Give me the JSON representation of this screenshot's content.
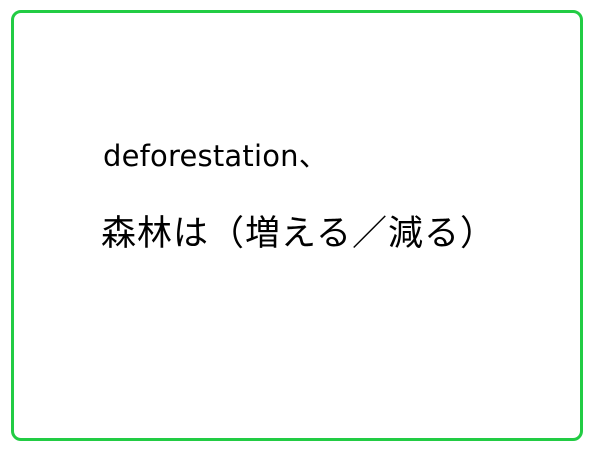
{
  "card": {
    "border_color": "#22cc44",
    "line1": "deforestation、",
    "line2": "森林は（増える／減る）"
  }
}
